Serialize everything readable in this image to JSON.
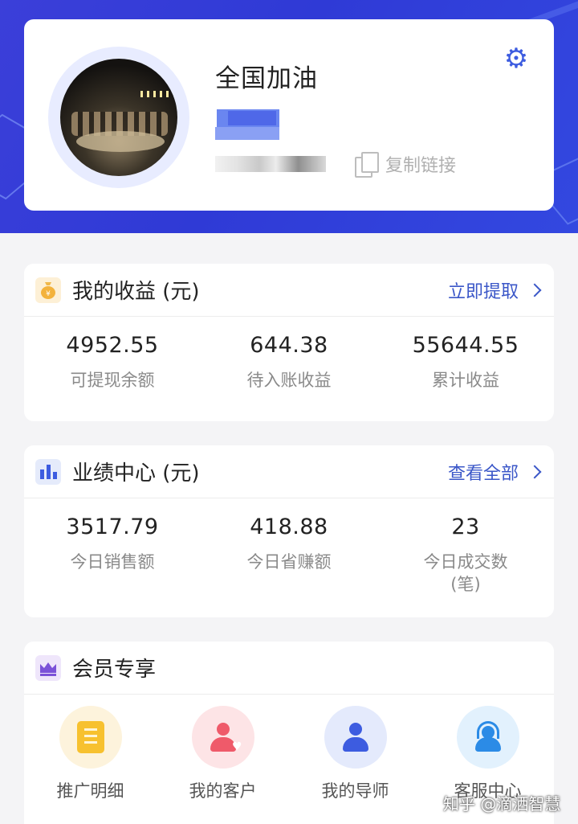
{
  "profile": {
    "username": "全国加油",
    "copy_link_label": "复制链接"
  },
  "earnings": {
    "title": "我的收益 (元)",
    "action": "立即提取",
    "stats": [
      {
        "value": "4952.55",
        "label": "可提现余额"
      },
      {
        "value": "644.38",
        "label": "待入账收益"
      },
      {
        "value": "55644.55",
        "label": "累计收益"
      }
    ]
  },
  "performance": {
    "title": "业绩中心 (元)",
    "action": "查看全部",
    "stats": [
      {
        "value": "3517.79",
        "label": "今日销售额"
      },
      {
        "value": "418.88",
        "label": "今日省赚额"
      },
      {
        "value": "23",
        "label": "今日成交数\n(笔)"
      }
    ]
  },
  "membership": {
    "title": "会员专享",
    "items": [
      {
        "label": "推广明细",
        "icon": "document-icon"
      },
      {
        "label": "我的客户",
        "icon": "customer-icon"
      },
      {
        "label": "我的导师",
        "icon": "mentor-icon"
      },
      {
        "label": "客服中心",
        "icon": "customer-service-icon"
      }
    ]
  },
  "watermark": "知乎 @滴洒智慧",
  "colors": {
    "hero": "#3b3fd9",
    "accent": "#3b57c8",
    "gear": "#3d5ce0"
  }
}
